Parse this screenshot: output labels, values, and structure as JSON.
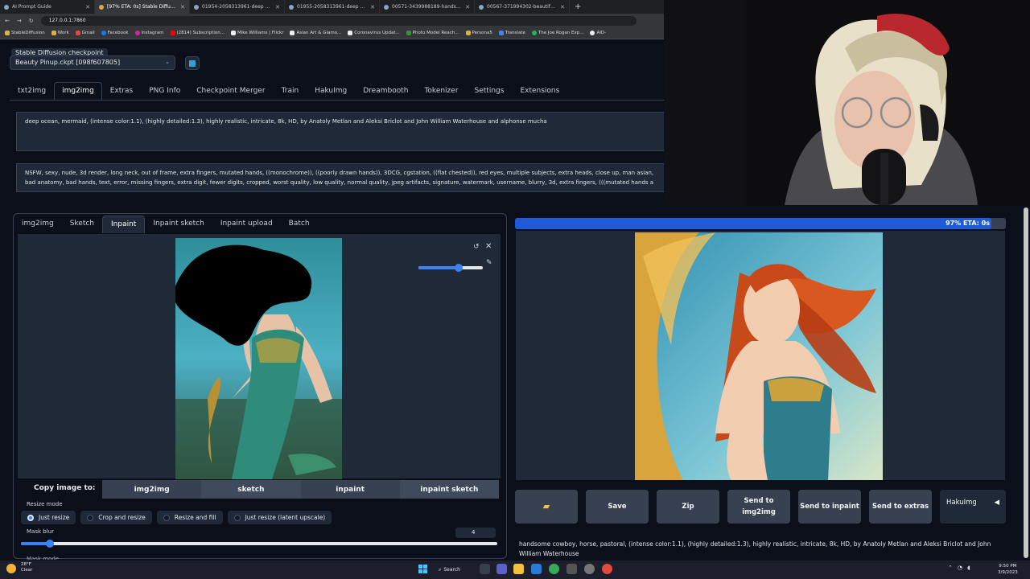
{
  "browser": {
    "tabs": [
      {
        "label": "AI Prompt Guide",
        "active": false
      },
      {
        "label": "[97% ETA: 0s] Stable Diffusion",
        "active": true
      },
      {
        "label": "01954-2058313961-deep ocean",
        "active": false
      },
      {
        "label": "01955-2058313961-deep ocean",
        "active": false
      },
      {
        "label": "00571-3439988189-handsome c",
        "active": false
      },
      {
        "label": "00567-371994302-beautiful bet",
        "active": false
      }
    ],
    "new_tab": "+",
    "url": "127.0.0.1:7860",
    "bookmarks": [
      "StableDiffusion",
      "Work",
      "Gmail",
      "Facebook",
      "Instagram",
      "(2814) Subscription...",
      "Mike Williams | Flickr",
      "Asian Art & Glamo...",
      "Coronavirus Updat...",
      "Photo Model Reach...",
      "Persona5",
      "Translate",
      "The Joe Rogan Exp...",
      "AID-"
    ]
  },
  "checkpoint": {
    "label": "Stable Diffusion checkpoint",
    "value": "Beauty Pinup.ckpt [098f607805]"
  },
  "main_tabs": [
    "txt2img",
    "img2img",
    "Extras",
    "PNG Info",
    "Checkpoint Merger",
    "Train",
    "HakuImg",
    "Dreambooth",
    "Tokenizer",
    "Settings",
    "Extensions"
  ],
  "main_tab_active": "img2img",
  "prompt": "deep ocean, mermaid, (intense color:1.1), (highly detailed:1.3), highly realistic, intricate, 8k, HD, by Anatoly Metlan and  Aleksi Briclot and  John William Waterhouse and alphonse mucha",
  "negative_prompt_line1": "NSFW, sexy, nude, 3d render, long neck, out of frame, extra fingers, mutated hands, ((monochrome)), ((poorly drawn hands)), 3DCG, cgstation, ((flat chested)), red eyes, multiple subjects, extra heads, close up, man asian,",
  "negative_prompt_line2": "bad anatomy, bad hands, text, error, missing fingers, extra digit, fewer digits, cropped, worst quality, low quality, normal quality, jpeg artifacts, signature, watermark, username, blurry, 3d, extra fingers, (((mutated hands a",
  "sub_tabs": [
    "img2img",
    "Sketch",
    "Inpaint",
    "Inpaint sketch",
    "Inpaint upload",
    "Batch"
  ],
  "sub_tab_active": "Inpaint",
  "brush_size_fraction": 0.62,
  "copy_image": {
    "label": "Copy image to:",
    "buttons": [
      "img2img",
      "sketch",
      "inpaint",
      "inpaint sketch"
    ]
  },
  "resize_mode": {
    "label": "Resize mode",
    "options": [
      "Just resize",
      "Crop and resize",
      "Resize and fill",
      "Just resize (latent upscale)"
    ],
    "selected": "Just resize"
  },
  "mask_blur": {
    "label": "Mask blur",
    "value": "4",
    "fraction": 0.06
  },
  "mask_mode_label": "Mask mode",
  "progress": {
    "text": "97% ETA: 0s",
    "percent": 97
  },
  "output_buttons": {
    "folder_icon": "folder-icon",
    "save": "Save",
    "zip": "Zip",
    "send_img2img_line1": "Send to",
    "send_img2img_line2": "img2img",
    "send_inpaint": "Send to inpaint",
    "send_extras": "Send to extras",
    "hakuimg": "HakuImg",
    "hakuimg_arrow": "◀"
  },
  "generation_info": "handsome cowboy, horse, pastoral, (intense color:1.1), (highly detailed:1.3), highly realistic, intricate, 8k, HD, by Anatoly Metlan and Aleksi Briclot and John William Waterhouse",
  "taskbar": {
    "weather_temp": "28°F",
    "weather_desc": "Clear",
    "search": "Search",
    "time": "9:50 PM",
    "date": "3/9/2023"
  },
  "colors": {
    "accent": "#1d5bd8",
    "panel": "#1f2937",
    "background": "#0b0f19"
  }
}
